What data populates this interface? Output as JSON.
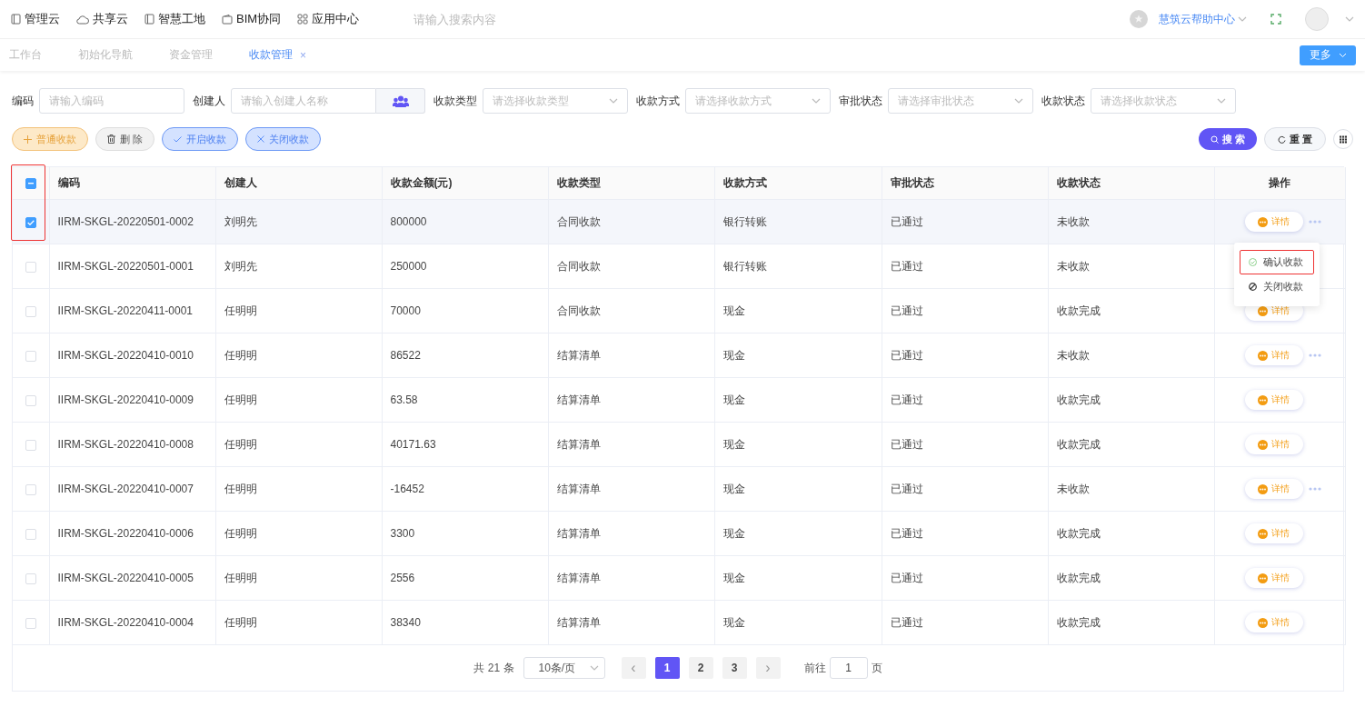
{
  "top_nav": [
    {
      "label": "管理云"
    },
    {
      "label": "共享云"
    },
    {
      "label": "智慧工地"
    },
    {
      "label": "BIM协同"
    },
    {
      "label": "应用中心"
    }
  ],
  "global_search": {
    "placeholder": "请输入搜索内容"
  },
  "help_center": "慧筑云帮助中心",
  "tabs": [
    {
      "label": "工作台",
      "selected": false,
      "closable": false
    },
    {
      "label": "初始化导航",
      "selected": false,
      "closable": false
    },
    {
      "label": "资金管理",
      "selected": false,
      "closable": false
    },
    {
      "label": "收款管理",
      "selected": true,
      "closable": true,
      "close_glyph": "×"
    }
  ],
  "more_button": "更多",
  "filters": [
    {
      "label": "编码",
      "kind": "input",
      "placeholder": "请输入编码"
    },
    {
      "label": "创建人",
      "kind": "picker",
      "placeholder": "请输入创建人名称"
    },
    {
      "label": "收款类型",
      "kind": "select",
      "placeholder": "请选择收款类型"
    },
    {
      "label": "收款方式",
      "kind": "select",
      "placeholder": "请选择收款方式"
    },
    {
      "label": "审批状态",
      "kind": "select",
      "placeholder": "请选择审批状态"
    },
    {
      "label": "收款状态",
      "kind": "select",
      "placeholder": "请选择收款状态"
    }
  ],
  "actions": [
    {
      "label": "普通收款",
      "kind": "add"
    },
    {
      "label": "删 除",
      "kind": "delete"
    },
    {
      "label": "开启收款",
      "kind": "open"
    },
    {
      "label": "关闭收款",
      "kind": "close"
    }
  ],
  "search_button": "搜 索",
  "reset_button": "重 置",
  "table": {
    "select_all": {
      "indeterminate": true
    },
    "select_column_outlined": true,
    "columns": [
      "编码",
      "创建人",
      "收款金额(元)",
      "收款类型",
      "收款方式",
      "审批状态",
      "收款状态",
      "操作"
    ],
    "rows": [
      {
        "checked": true,
        "more": true,
        "cells": [
          "IIRM-SKGL-20220501-0002",
          "刘明先",
          "800000",
          "合同收款",
          "银行转账",
          "已通过",
          "未收款"
        ],
        "action": "详情"
      },
      {
        "checked": false,
        "more": false,
        "cells": [
          "IIRM-SKGL-20220501-0001",
          "刘明先",
          "250000",
          "合同收款",
          "银行转账",
          "已通过",
          "未收款"
        ]
      },
      {
        "checked": false,
        "more": false,
        "cells": [
          "IIRM-SKGL-20220411-0001",
          "任明明",
          "70000",
          "合同收款",
          "现金",
          "已通过",
          "收款完成"
        ],
        "action": "详情"
      },
      {
        "checked": false,
        "more": true,
        "cells": [
          "IIRM-SKGL-20220410-0010",
          "任明明",
          "86522",
          "结算清单",
          "现金",
          "已通过",
          "未收款"
        ],
        "action": "详情"
      },
      {
        "checked": false,
        "more": false,
        "cells": [
          "IIRM-SKGL-20220410-0009",
          "任明明",
          "63.58",
          "结算清单",
          "现金",
          "已通过",
          "收款完成"
        ],
        "action": "详情"
      },
      {
        "checked": false,
        "more": false,
        "cells": [
          "IIRM-SKGL-20220410-0008",
          "任明明",
          "40171.63",
          "结算清单",
          "现金",
          "已通过",
          "收款完成"
        ],
        "action": "详情"
      },
      {
        "checked": false,
        "more": true,
        "cells": [
          "IIRM-SKGL-20220410-0007",
          "任明明",
          "-16452",
          "结算清单",
          "现金",
          "已通过",
          "未收款"
        ],
        "action": "详情"
      },
      {
        "checked": false,
        "more": false,
        "cells": [
          "IIRM-SKGL-20220410-0006",
          "任明明",
          "3300",
          "结算清单",
          "现金",
          "已通过",
          "收款完成"
        ],
        "action": "详情"
      },
      {
        "checked": false,
        "more": false,
        "cells": [
          "IIRM-SKGL-20220410-0005",
          "任明明",
          "2556",
          "结算清单",
          "现金",
          "已通过",
          "收款完成"
        ],
        "action": "详情"
      },
      {
        "checked": false,
        "more": false,
        "cells": [
          "IIRM-SKGL-20220410-0004",
          "任明明",
          "38340",
          "结算清单",
          "现金",
          "已通过",
          "收款完成"
        ],
        "action": "详情"
      }
    ]
  },
  "row_menu": [
    {
      "label": "确认收款",
      "kind": "confirm",
      "highlighted": true
    },
    {
      "label": "关闭收款",
      "kind": "close",
      "highlighted": false
    }
  ],
  "pagination": {
    "total": "共 21 条",
    "page_size": "10条/页",
    "prev": "‹",
    "pages": [
      {
        "label": "1",
        "selected": true
      },
      {
        "label": "2",
        "selected": false
      },
      {
        "label": "3",
        "selected": false
      }
    ],
    "next": "›",
    "goto_label": "前往",
    "goto_value": "1",
    "goto_suffix": "页"
  }
}
